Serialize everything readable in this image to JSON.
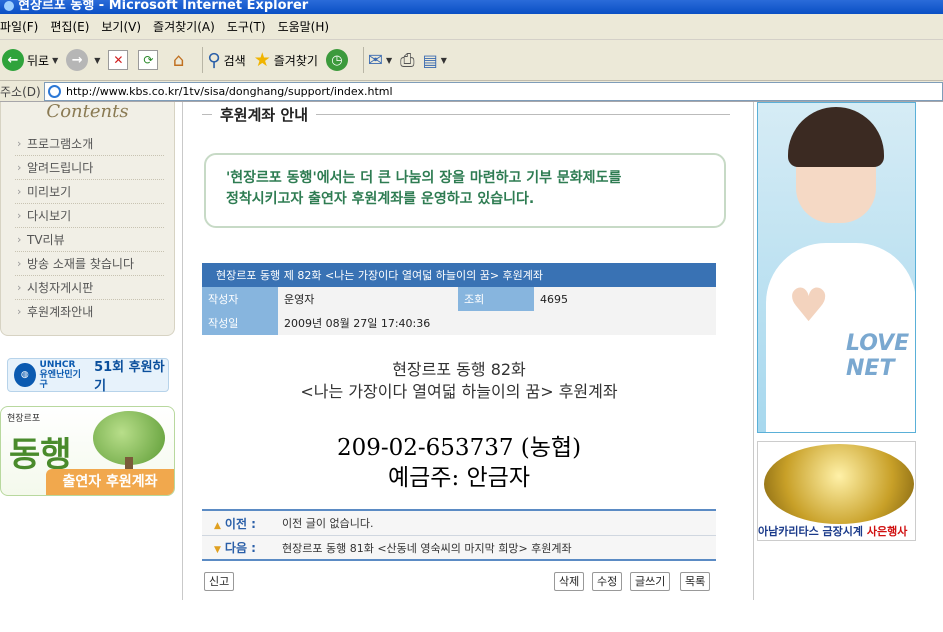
{
  "window": {
    "title": "현장르포 동행 - Microsoft Internet Explorer"
  },
  "menu": [
    "파일(F)",
    "편집(E)",
    "보기(V)",
    "즐겨찾기(A)",
    "도구(T)",
    "도움말(H)"
  ],
  "toolbar": {
    "back_label": "뒤로",
    "search_label": "검색",
    "favorites_label": "즐겨찾기"
  },
  "address": {
    "label": "주소(D)",
    "url": "http://www.kbs.co.kr/1tv/sisa/donghang/support/index.html"
  },
  "leftnav": {
    "title": "Contents",
    "items": [
      "프로그램소개",
      "알려드립니다",
      "미리보기",
      "다시보기",
      "TV리뷰",
      "방송 소재를 찾습니다",
      "시청자게시판",
      "후원계좌안내"
    ]
  },
  "banners": {
    "unhcr_logo": "UNHCR",
    "unhcr_logo_sub": "유엔난민기구",
    "unhcr_text": "51회 후원하기",
    "donghang_small": "현장르포",
    "donghang_big": "동행",
    "donghang_support": "출연자 후원계좌"
  },
  "section": {
    "title": "후원계좌 안내"
  },
  "notice": {
    "line1": "'현장르포 동행'에서는 더 큰 나눔의 장을 마련하고 기부 문화제도를",
    "line2": "정착시키고자 출연자 후원계좌를 운영하고 있습니다."
  },
  "post": {
    "title": "현장르포 동행 제 82화 <나는 가장이다 열여덟 하늘이의 꿈> 후원계좌",
    "author_label": "작성자",
    "author": "운영자",
    "views_label": "조회",
    "views": "4695",
    "date_label": "작성일",
    "date": "2009년 08월 27일 17:40:36"
  },
  "body": {
    "line1": "현장르포 동행 82화",
    "line2": "<나는 가장이다 열여덟 하늘이의 꿈> 후원계좌",
    "account": "209-02-653737 (농협)",
    "holder": "예금주: 안금자"
  },
  "prevnext": {
    "prev_label": "이전 :",
    "prev_text": "이전 글이 없습니다.",
    "next_label": "다음 :",
    "next_text": "현장르포 동행 81화 <산동네 영숙씨의 마지막 희망> 후원계좌"
  },
  "buttons": {
    "report": "신고",
    "delete": "삭제",
    "edit": "수정",
    "write": "글쓰기",
    "list": "목록"
  },
  "ads": {
    "ad1_text": "LOVE NET",
    "ad2_brand": "아남카리타스 금장시계",
    "ad2_red": "사은행사"
  }
}
